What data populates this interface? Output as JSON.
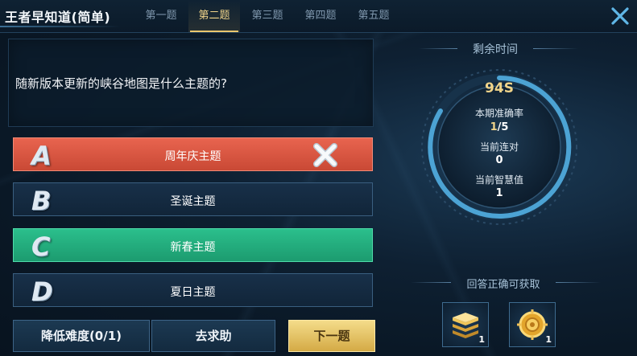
{
  "header": {
    "title": "王者早知道(简单)",
    "tabs": [
      {
        "label": "第一题",
        "active": false
      },
      {
        "label": "第二题",
        "active": true
      },
      {
        "label": "第三题",
        "active": false
      },
      {
        "label": "第四题",
        "active": false
      },
      {
        "label": "第五题",
        "active": false
      }
    ],
    "close_icon": "close-icon"
  },
  "question": {
    "text": "随新版本更新的峡谷地图是什么主题的?"
  },
  "options": [
    {
      "letter": "A",
      "text": "周年庆主题",
      "state": "wrong"
    },
    {
      "letter": "B",
      "text": "圣诞主题",
      "state": "normal"
    },
    {
      "letter": "C",
      "text": "新春主题",
      "state": "correct"
    },
    {
      "letter": "D",
      "text": "夏日主题",
      "state": "normal"
    }
  ],
  "buttons": {
    "lower_difficulty": "降低难度(0/1)",
    "ask_help": "去求助",
    "next": "下一题"
  },
  "timer": {
    "label": "剩余时间",
    "value": "94S",
    "accuracy_label": "本期准确率",
    "accuracy_correct": "1",
    "accuracy_total": "/5",
    "streak_label": "当前连对",
    "streak_value": "0",
    "wisdom_label": "当前智慧值",
    "wisdom_value": "1"
  },
  "rewards": {
    "label": "回答正确可获取",
    "items": [
      {
        "icon": "book-stack-icon",
        "count": "1"
      },
      {
        "icon": "gold-token-icon",
        "count": "1"
      }
    ]
  },
  "colors": {
    "gold": "#e9c66e",
    "wrong": "#e25d48",
    "correct": "#25b182",
    "timer_ring": "#4ca3d4"
  }
}
